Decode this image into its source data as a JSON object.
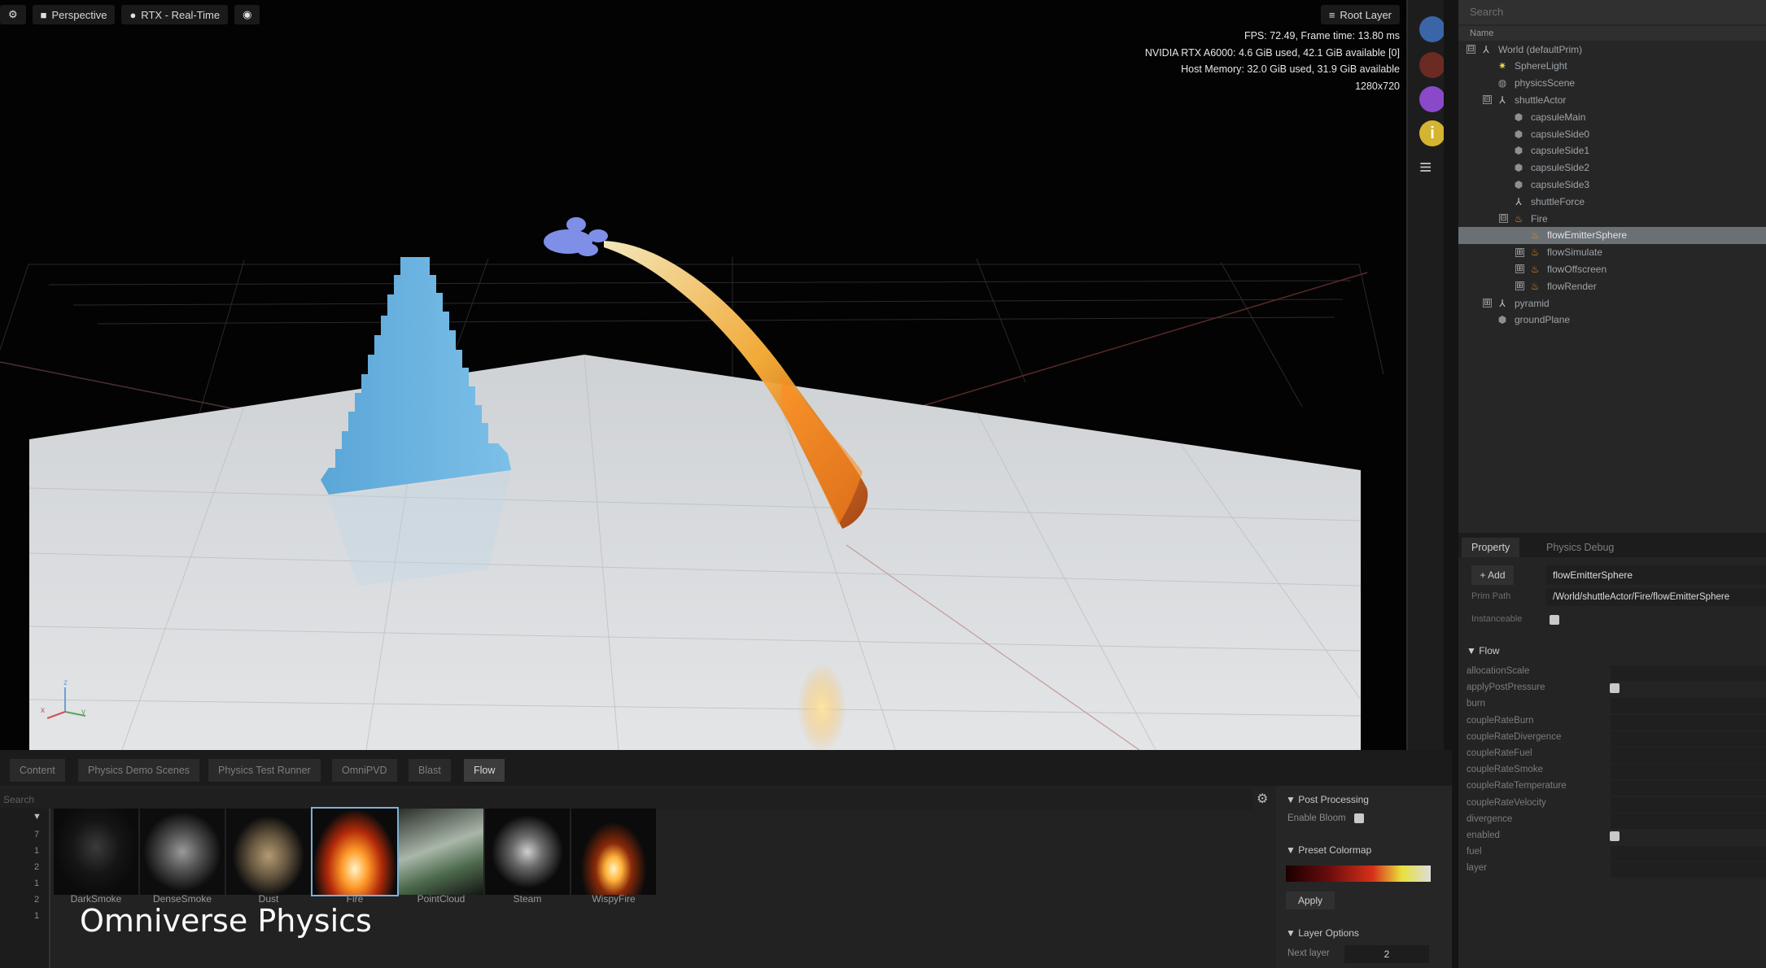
{
  "viewport": {
    "toolbar": {
      "camera_label": "Perspective",
      "renderer_label": "RTX - Real-Time",
      "root_layer": "Root Layer"
    },
    "stats": {
      "fps": "FPS: 72.49, Frame time: 13.80 ms",
      "gpu": "NVIDIA RTX A6000: 4.6 GiB used,  42.1 GiB available [0]",
      "host": "Host Memory: 32.0 GiB used, 31.9 GiB available",
      "resolution": "1280x720"
    },
    "axis": {
      "x": "x",
      "y": "y",
      "z": "z"
    }
  },
  "stage": {
    "search_placeholder": "Search",
    "column_name": "Name",
    "items": [
      {
        "label": "World (defaultPrim)",
        "expander": "⊟"
      },
      {
        "label": "SphereLight",
        "expander": ""
      },
      {
        "label": "physicsScene",
        "expander": ""
      },
      {
        "label": "shuttleActor",
        "expander": "⊟"
      },
      {
        "label": "capsuleMain",
        "expander": ""
      },
      {
        "label": "capsuleSide0",
        "expander": ""
      },
      {
        "label": "capsuleSide1",
        "expander": ""
      },
      {
        "label": "capsuleSide2",
        "expander": ""
      },
      {
        "label": "capsuleSide3",
        "expander": ""
      },
      {
        "label": "shuttleForce",
        "expander": ""
      },
      {
        "label": "Fire",
        "expander": "⊟"
      },
      {
        "label": "flowEmitterSphere",
        "expander": ""
      },
      {
        "label": "flowSimulate",
        "expander": "⊞"
      },
      {
        "label": "flowOffscreen",
        "expander": "⊞"
      },
      {
        "label": "flowRender",
        "expander": "⊞"
      },
      {
        "label": "pyramid",
        "expander": "⊞"
      },
      {
        "label": "groundPlane",
        "expander": ""
      }
    ]
  },
  "property": {
    "tabs": [
      "Property",
      "Physics Debug"
    ],
    "add_label": "Add",
    "prim_name": "flowEmitterSphere",
    "prim_path_label": "Prim Path",
    "prim_path": "/World/shuttleActor/Fire/flowEmitterSphere",
    "instanceable_label": "Instanceable",
    "section": "Flow",
    "rows": [
      "allocationScale",
      "applyPostPressure",
      "burn",
      "coupleRateBurn",
      "coupleRateDivergence",
      "coupleRateFuel",
      "coupleRateSmoke",
      "coupleRateTemperature",
      "coupleRateVelocity",
      "divergence",
      "enabled",
      "fuel",
      "layer"
    ]
  },
  "dock": {
    "tabs": [
      "Content",
      "Physics Demo Scenes",
      "Physics Test Runner",
      "OmniPVD",
      "Blast",
      "Flow"
    ],
    "search_placeholder": "Search",
    "side_numbers": [
      "7",
      "1",
      "2",
      "1",
      "2",
      "1"
    ],
    "presets": [
      "DarkSmoke",
      "DenseSmoke",
      "Dust",
      "Fire",
      "PointCloud",
      "Steam",
      "WispyFire"
    ],
    "post_processing": "Post Processing",
    "enable_bloom": "Enable Bloom",
    "preset_colormap": "Preset Colormap",
    "apply_label": "Apply",
    "layer_options": "Layer Options",
    "next_layer_label": "Next layer",
    "next_layer_value": "2"
  },
  "overlay_title": "Omniverse Physics",
  "colors": {
    "accent": "#76b900",
    "selection": "#6b7075",
    "pyramid": "#6ab3e0",
    "fire": "#ffb23a"
  }
}
